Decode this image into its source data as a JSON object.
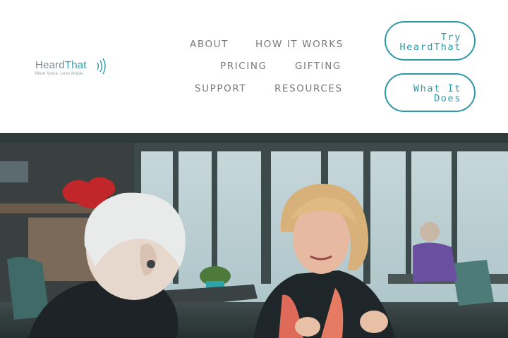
{
  "brand": {
    "name_part1": "Heard",
    "name_part2": "That",
    "tagline": "More Voice. Less Noise.",
    "accent_color": "#2e9aa8"
  },
  "nav": {
    "about": "ABOUT",
    "how_it_works": "HOW IT WORKS",
    "pricing": "PRICING",
    "gifting": "GIFTING",
    "support": "SUPPORT",
    "resources": "RESOURCES"
  },
  "cta": {
    "try_line1": "Try",
    "try_line2": "HeardThat",
    "what_line1": "What It",
    "what_line2": "Does"
  },
  "hero": {
    "icon": "restaurant-conversation-photo"
  }
}
